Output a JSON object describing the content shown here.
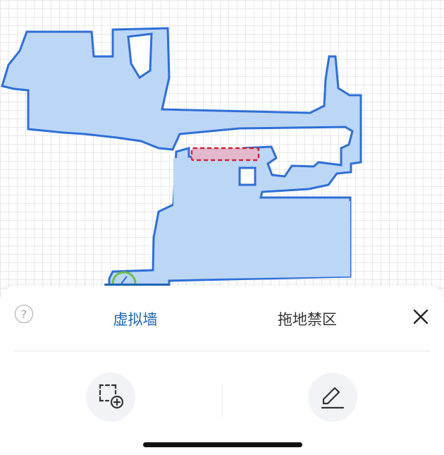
{
  "map": {
    "floor_color": "#bcd6f6",
    "edge_color": "#2f6fd6",
    "zone_fill": "#e3b8cc",
    "zone_border": "#d2233a",
    "dock_color": "#6cc04a"
  },
  "panel": {
    "help_symbol": "?",
    "tabs": [
      {
        "label": "虚拟墙",
        "active": true
      },
      {
        "label": "拖地禁区",
        "active": false
      }
    ],
    "accent_color": "#1f64b3",
    "tools": [
      {
        "icon": "add-area-icon"
      },
      {
        "icon": "pencil-icon"
      }
    ],
    "close_icon": "close-icon"
  }
}
